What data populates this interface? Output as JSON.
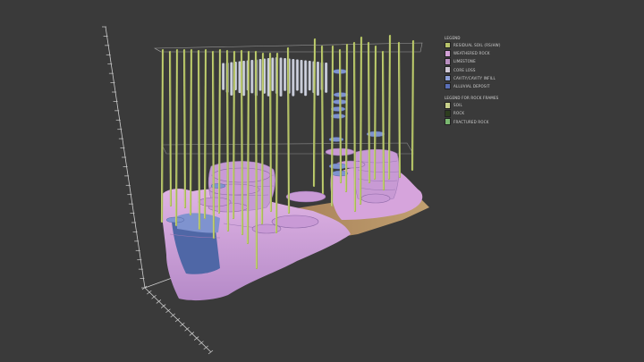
{
  "legend": {
    "title": "LEGEND",
    "items": [
      {
        "label": "RESIDUAL SOIL (RS/HW)",
        "color": "#b8c46a"
      },
      {
        "label": "WEATHERED ROCK",
        "color": "#d2a0d6"
      },
      {
        "label": "LIMESTONE",
        "color": "#b98fc0"
      },
      {
        "label": "CORE LOSS",
        "color": "#cfc7d4"
      },
      {
        "label": "CAVITY/CAVITY INFILL",
        "color": "#8ea0d8"
      },
      {
        "label": "ALLUVIAL DEPOSIT",
        "color": "#5a6fb8"
      }
    ],
    "subtitle": "LEGEND FOR ROCK FRAMES",
    "sub_items": [
      {
        "label": "SOIL",
        "color": "#c8d08a"
      },
      {
        "label": "ROCK",
        "color": "#2d3d1e"
      },
      {
        "label": "FRACTURED ROCK",
        "color": "#7ab870"
      }
    ]
  },
  "colors": {
    "background": "#3a3a3a",
    "borehole": "#a8b85a",
    "rock": "#d2a0d6",
    "rock_dark": "#9a78b8",
    "cavity": "#7f93cf",
    "alluvium": "#5068a8",
    "sand": "#c9a16a",
    "core_loss": "#c8ccd6",
    "axis": "#cfcfcf"
  }
}
